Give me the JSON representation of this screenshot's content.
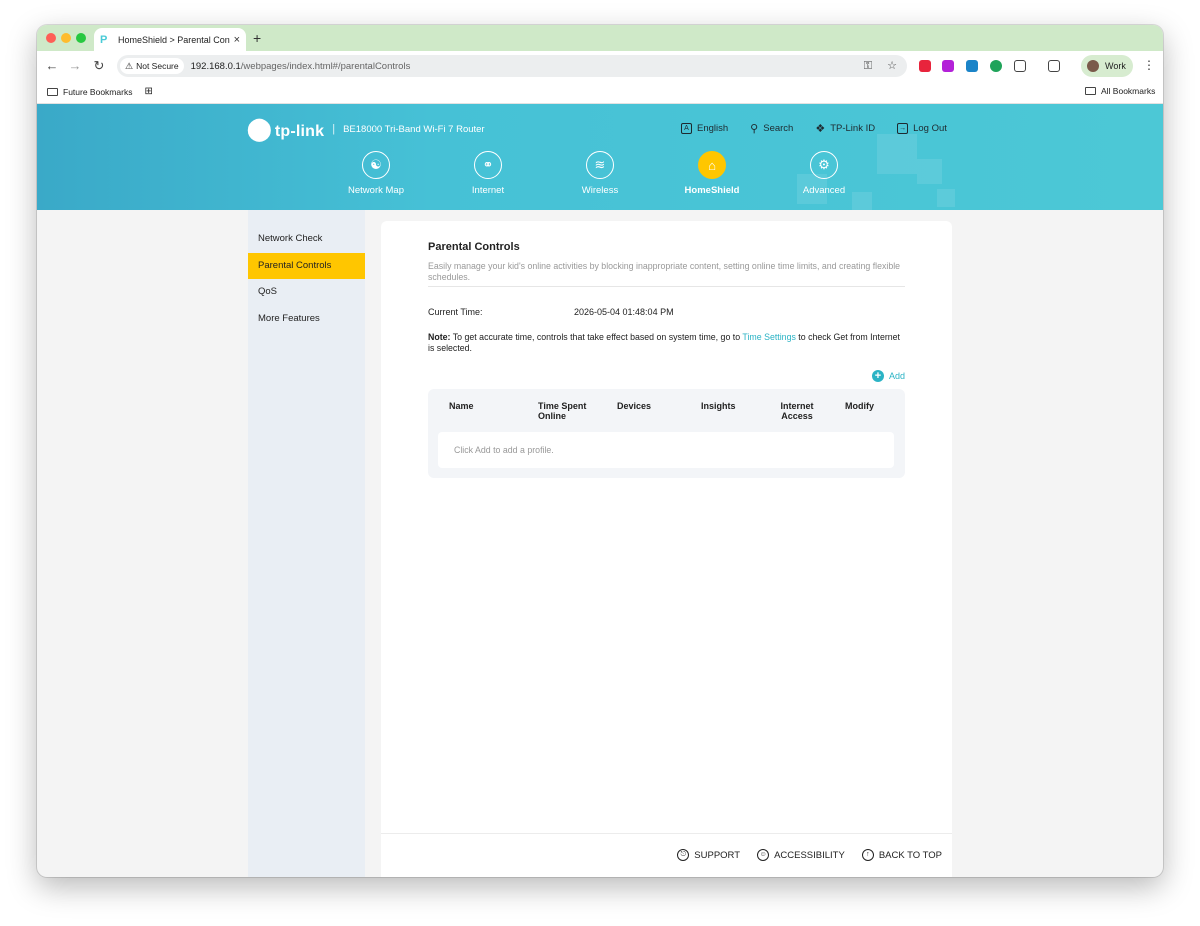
{
  "browser": {
    "tab_title": "HomeShield > Parental Controls",
    "tab_close": "×",
    "new_tab": "+",
    "security_label": "Not Secure",
    "url_host": "192.168.0.1",
    "url_path": "/webpages/index.html#/parentalControls",
    "profile_name": "Work",
    "bookmarks_left": "Future Bookmarks",
    "bookmarks_right": "All Bookmarks"
  },
  "router": {
    "brand": "tp-link",
    "model": "BE18000 Tri-Band Wi-Fi 7 Router",
    "top_links": [
      "English",
      "Search",
      "TP-Link ID",
      "Log Out"
    ],
    "nav": [
      "Network Map",
      "Internet",
      "Wireless",
      "HomeShield",
      "Advanced"
    ],
    "active_nav": "HomeShield"
  },
  "sidebar": {
    "items": [
      "Network Check",
      "Parental Controls",
      "QoS",
      "More Features"
    ],
    "active": "Parental Controls"
  },
  "content": {
    "title": "Parental Controls",
    "description": "Easily manage your kid's online activities by blocking inappropriate content, setting online time limits, and creating flexible schedules.",
    "current_time_label": "Current Time:",
    "current_time_value": "2026-05-04 01:48:04 PM",
    "note_prefix": "Note:",
    "note_text1": " To get accurate time, controls that take effect based on system time, go to ",
    "note_link": "Time Settings",
    "note_text2": " to check Get from Internet is selected.",
    "add_label": "Add",
    "columns": [
      "Name",
      "Time Spent Online",
      "Devices",
      "Insights",
      "Internet Access",
      "Modify"
    ],
    "empty_message": "Click Add to add a profile."
  },
  "footer": {
    "links": [
      "SUPPORT",
      "ACCESSIBILITY",
      "BACK TO TOP"
    ]
  },
  "colors": {
    "accent": "#ffc600",
    "header": "#4cc8d6",
    "link": "#2bb3c5"
  }
}
